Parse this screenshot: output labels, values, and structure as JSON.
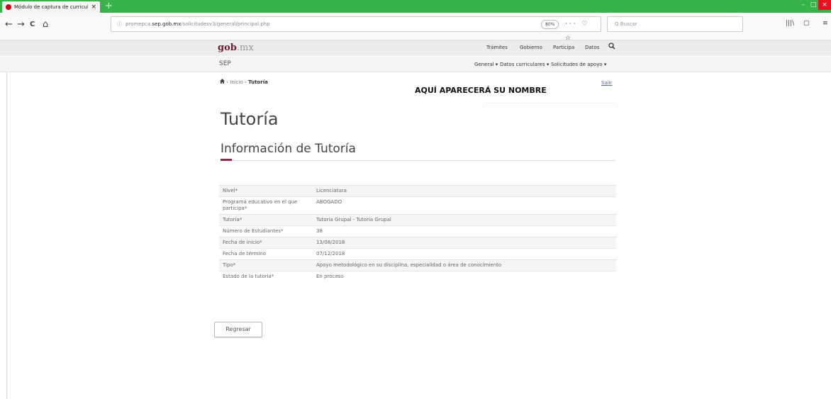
{
  "browser": {
    "tab_title": "Módulo de captura de curricul",
    "tab_close": "×",
    "new_tab": "+",
    "url_host": "promepca.sep.gob.mx",
    "url_prefix": "promepca.",
    "url_bold": "sep.gob.mx",
    "url_path": "/solicitudesv3/general/principal.php",
    "zoom": "80%",
    "page_actions": "··· ♡ ☆",
    "search_placeholder": "Q Buscar",
    "back": "←",
    "forward": "→",
    "reload": "C",
    "home": "⌂",
    "library": "|||\\",
    "sidebar": "▢",
    "menu": "≡",
    "minimize": "–",
    "maximize": "□",
    "close": "×"
  },
  "gob_header": {
    "logo_main": "gob",
    "logo_suffix": ".mx",
    "nav": [
      "Trámites",
      "Gobierno",
      "Participa",
      "Datos"
    ],
    "search_icon": "magnifier-icon"
  },
  "sep_header": {
    "brand": "SEP",
    "menus": [
      "General ▾",
      "Datos curriculares ▾",
      "Solicitudes de apoyo ▾"
    ]
  },
  "breadcrumb": {
    "home_icon": "home-icon",
    "sep1": "›",
    "inicio": "Inicio",
    "sep2": "›",
    "current": "Tutoría"
  },
  "user": {
    "name": "AQUÍ APARECERÁ SU NOMBRE",
    "logout": "Salir"
  },
  "page": {
    "title": "Tutoría",
    "section_title": "Información de Tutoría"
  },
  "details": [
    {
      "label": "Nivel*",
      "value": "Licenciatura"
    },
    {
      "label": "Programa educativo en el que participa*",
      "value": "ABOGADO"
    },
    {
      "label": "Tutoría*",
      "value": "Tutoría Grupal - Tutoría Grupal"
    },
    {
      "label": "Número de Estudiantes*",
      "value": "38"
    },
    {
      "label": "Fecha de inicio*",
      "value": "13/08/2018"
    },
    {
      "label": "Fecha de término",
      "value": "07/12/2018"
    },
    {
      "label": "Tipo*",
      "value": "Apoyo metodológico en su disciplina, especialidad o área de conocimiento"
    },
    {
      "label": "Estado de la tutoría*",
      "value": "En proceso"
    }
  ],
  "actions": {
    "back_button": "Regresar"
  },
  "colors": {
    "tabbar": "#37b34a",
    "brand_maroon": "#6f1d2d",
    "accent": "#9d2449"
  }
}
